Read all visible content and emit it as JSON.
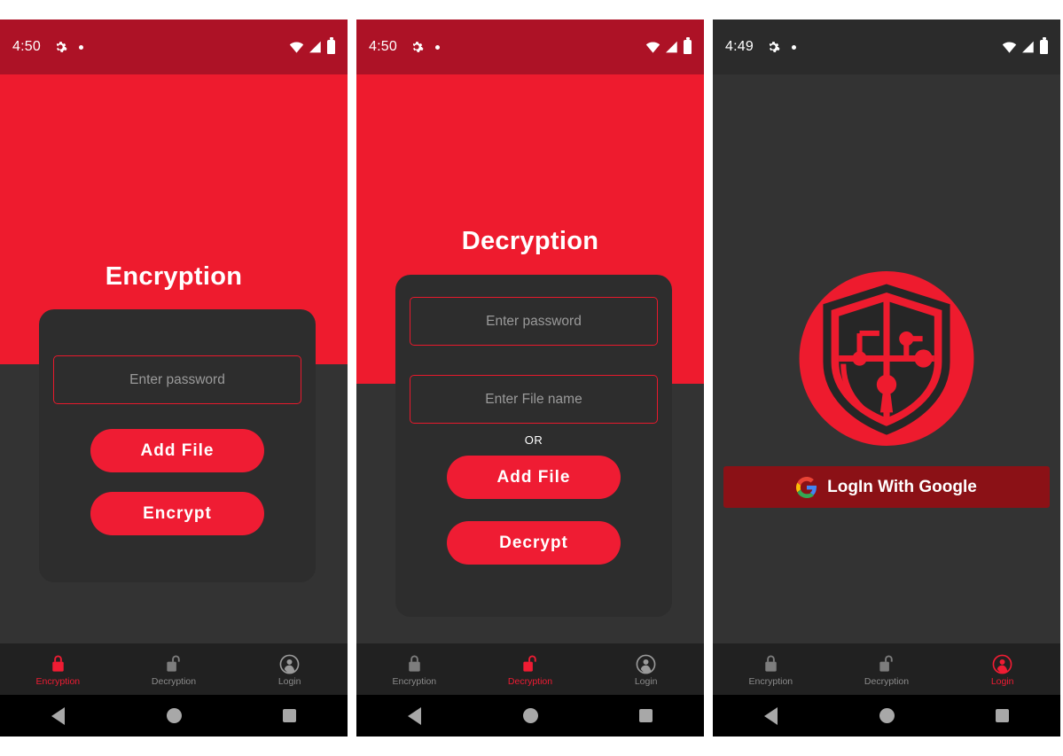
{
  "app": {
    "accent_red": "#ef1c33",
    "header_red": "#ee1b2e",
    "status_red": "#ad1226",
    "dark_bg": "#333333",
    "card_bg": "#2d2d2d",
    "tabbar_bg": "#212121",
    "google_btn_bg": "#8b1116"
  },
  "screens": [
    {
      "id": "encryption",
      "status": {
        "time": "4:50",
        "gear_icon": "gear-icon",
        "dot_icon": "dot-icon",
        "wifi_icon": "wifi-icon",
        "signal_icon": "signal-icon",
        "battery_icon": "battery-icon"
      },
      "title": "Encryption",
      "fields": [
        {
          "name": "password-input",
          "placeholder": "Enter password",
          "value": ""
        }
      ],
      "buttons": [
        {
          "name": "add-file-button",
          "label": "Add File"
        },
        {
          "name": "encrypt-button",
          "label": "Encrypt"
        }
      ],
      "tabs": [
        {
          "name": "tab-encryption",
          "label": "Encryption",
          "icon": "lock-closed-icon",
          "active": true
        },
        {
          "name": "tab-decryption",
          "label": "Decryption",
          "icon": "lock-open-icon",
          "active": false
        },
        {
          "name": "tab-login",
          "label": "Login",
          "icon": "account-circle-icon",
          "active": false
        }
      ],
      "nav": [
        {
          "name": "nav-back-button",
          "icon": "triangle-back-icon"
        },
        {
          "name": "nav-home-button",
          "icon": "circle-home-icon"
        },
        {
          "name": "nav-recents-button",
          "icon": "square-recents-icon"
        }
      ]
    },
    {
      "id": "decryption",
      "status": {
        "time": "4:50",
        "gear_icon": "gear-icon",
        "dot_icon": "dot-icon",
        "wifi_icon": "wifi-icon",
        "signal_icon": "signal-icon",
        "battery_icon": "battery-icon"
      },
      "title": "Decryption",
      "fields": [
        {
          "name": "password-input",
          "placeholder": "Enter password",
          "value": ""
        },
        {
          "name": "file-name-input",
          "placeholder": "Enter File name",
          "value": ""
        }
      ],
      "divider_label": "OR",
      "buttons": [
        {
          "name": "add-file-button",
          "label": "Add File"
        },
        {
          "name": "decrypt-button",
          "label": "Decrypt"
        }
      ],
      "tabs": [
        {
          "name": "tab-encryption",
          "label": "Encryption",
          "icon": "lock-closed-icon",
          "active": false
        },
        {
          "name": "tab-decryption",
          "label": "Decryption",
          "icon": "lock-open-icon",
          "active": true
        },
        {
          "name": "tab-login",
          "label": "Login",
          "icon": "account-circle-icon",
          "active": false
        }
      ],
      "nav": [
        {
          "name": "nav-back-button",
          "icon": "triangle-back-icon"
        },
        {
          "name": "nav-home-button",
          "icon": "circle-home-icon"
        },
        {
          "name": "nav-recents-button",
          "icon": "square-recents-icon"
        }
      ]
    },
    {
      "id": "login",
      "status": {
        "time": "4:49",
        "gear_icon": "gear-icon",
        "dot_icon": "dot-icon",
        "wifi_icon": "wifi-icon",
        "signal_icon": "signal-icon",
        "battery_icon": "battery-icon"
      },
      "logo": {
        "name": "app-logo-shield-icon"
      },
      "google_button": {
        "name": "login-with-google-button",
        "label": "LogIn With Google",
        "icon": "google-g-icon"
      },
      "tabs": [
        {
          "name": "tab-encryption",
          "label": "Encryption",
          "icon": "lock-closed-icon",
          "active": false
        },
        {
          "name": "tab-decryption",
          "label": "Decryption",
          "icon": "lock-open-icon",
          "active": false
        },
        {
          "name": "tab-login",
          "label": "Login",
          "icon": "account-circle-icon",
          "active": true
        }
      ],
      "nav": [
        {
          "name": "nav-back-button",
          "icon": "triangle-back-icon"
        },
        {
          "name": "nav-home-button",
          "icon": "circle-home-icon"
        },
        {
          "name": "nav-recents-button",
          "icon": "square-recents-icon"
        }
      ]
    }
  ]
}
